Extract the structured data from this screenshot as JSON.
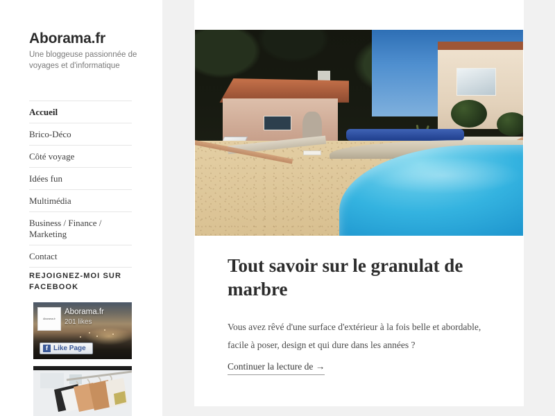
{
  "site": {
    "title": "Aborama.fr",
    "description": "Une bloggeuse passionnée de voyages et d'informatique"
  },
  "nav": {
    "items": [
      {
        "label": "Accueil",
        "active": true
      },
      {
        "label": "Brico-Déco",
        "active": false
      },
      {
        "label": "Côté voyage",
        "active": false
      },
      {
        "label": "Idées fun",
        "active": false
      },
      {
        "label": "Multimédia",
        "active": false
      },
      {
        "label": "Business / Finance / Marketing",
        "active": false
      },
      {
        "label": "Contact",
        "active": false
      }
    ]
  },
  "widgets": {
    "facebook": {
      "title": "Rejoignez-moi sur Facebook",
      "page_name": "Aborama.fr",
      "likes": "201 likes",
      "like_button": "Like Page",
      "profile_label": "Aborama.fr",
      "f_glyph": "f"
    },
    "clothes_thumb": {
      "alt": "portant de vêtements sur cintres"
    }
  },
  "article": {
    "hero_alt": "piscine bleue avec terrasse en granulat de marbre devant une villa",
    "title": "Tout savoir sur le granulat de marbre",
    "excerpt": "Vous avez rêvé d'une surface d'extérieur à la fois belle et abordable, facile à poser, design et qui dure dans les années ?",
    "read_more": "Continuer la lecture de",
    "read_more_arrow": "→"
  },
  "colors": {
    "page_background": "#f1f1f1",
    "card_background": "#ffffff",
    "text_primary": "#2c2c2c",
    "text_muted": "#7a7a7a",
    "rule": "#e6e6e6",
    "facebook_blue": "#3b5998",
    "pool_blue": "#34b3e0",
    "deck_beige": "#dec79a"
  }
}
